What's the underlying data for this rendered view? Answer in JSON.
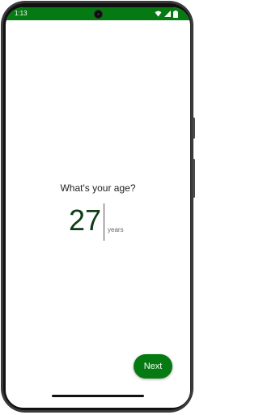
{
  "status_bar": {
    "time": "1:13",
    "background_color": "#067a12",
    "icons": [
      "wifi-icon",
      "signal-icon",
      "battery-icon"
    ]
  },
  "question": "What's your age?",
  "age": {
    "value": "27",
    "unit": "years"
  },
  "next_button": {
    "label": "Next",
    "color": "#067a12"
  }
}
